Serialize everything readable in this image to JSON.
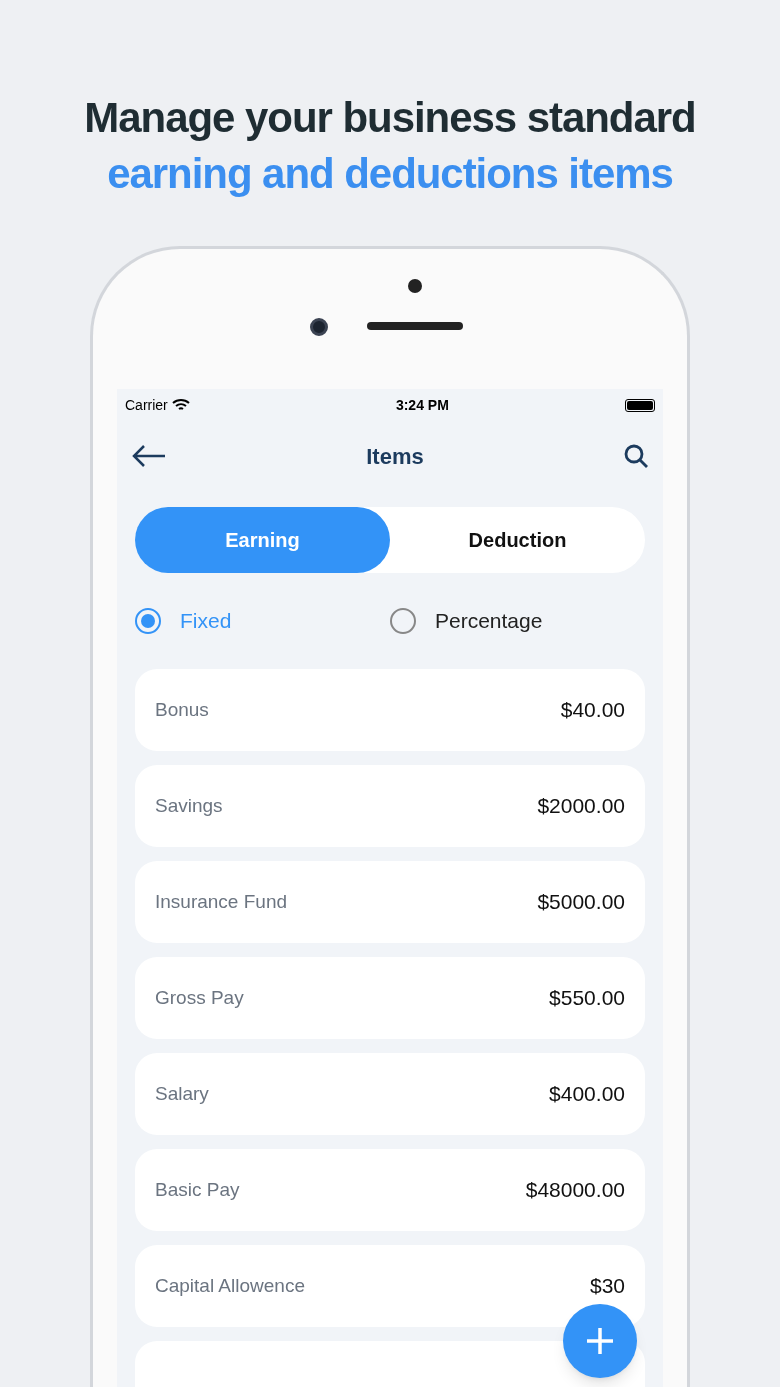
{
  "headline": {
    "line_1": "Manage your business standard",
    "line_2": "earning and deductions items"
  },
  "status_bar": {
    "carrier": "Carrier",
    "time": "3:24 PM"
  },
  "nav": {
    "title": "Items"
  },
  "tabs": [
    {
      "label": "Earning",
      "selected": true
    },
    {
      "label": "Deduction",
      "selected": false
    }
  ],
  "types": [
    {
      "label": "Fixed",
      "selected": true
    },
    {
      "label": "Percentage",
      "selected": false
    }
  ],
  "items": [
    {
      "name": "Bonus",
      "amount": "$40.00"
    },
    {
      "name": "Savings",
      "amount": "$2000.00"
    },
    {
      "name": "Insurance Fund",
      "amount": "$5000.00"
    },
    {
      "name": "Gross Pay",
      "amount": "$550.00"
    },
    {
      "name": "Salary",
      "amount": "$400.00"
    },
    {
      "name": "Basic Pay",
      "amount": "$48000.00"
    },
    {
      "name": "Capital Allowence",
      "amount": "$30"
    }
  ]
}
